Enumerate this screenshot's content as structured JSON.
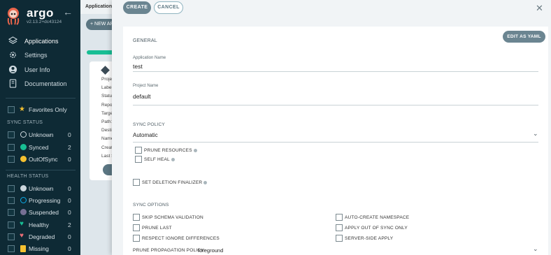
{
  "brand": {
    "name": "argo",
    "version": "v2.13.2+dc43124"
  },
  "nav": [
    {
      "label": "Applications",
      "icon": "layers-icon"
    },
    {
      "label": "Settings",
      "icon": "gear-icon"
    },
    {
      "label": "User Info",
      "icon": "user-icon"
    },
    {
      "label": "Documentation",
      "icon": "book-icon"
    }
  ],
  "favorites_label": "Favorites Only",
  "sync_status": {
    "title": "SYNC STATUS",
    "items": [
      {
        "label": "Unknown",
        "count": "0",
        "color": "#cfdae0"
      },
      {
        "label": "Synced",
        "count": "2",
        "color": "#18be94"
      },
      {
        "label": "OutOfSync",
        "count": "0",
        "color": "#f4c030"
      }
    ]
  },
  "health_status": {
    "title": "HEALTH STATUS",
    "items": [
      {
        "label": "Unknown",
        "count": "0",
        "color": "#ccd6dd"
      },
      {
        "label": "Progressing",
        "count": "0",
        "color": "#0dadea"
      },
      {
        "label": "Suspended",
        "count": "0",
        "color": "#766f94"
      },
      {
        "label": "Healthy",
        "count": "2",
        "color": "#18be94"
      },
      {
        "label": "Degraded",
        "count": "0",
        "color": "#e96d76"
      },
      {
        "label": "Missing",
        "count": "0",
        "color": "#f4c030"
      }
    ]
  },
  "background": {
    "breadcrumb": "Applications",
    "new_app_label": "+ NEW APP",
    "card_fields": [
      "Project:",
      "Labels:",
      "Status:",
      "Repository:",
      "Target R...",
      "Path:",
      "Destination:",
      "Namespace:",
      "Created At:",
      "Last Sync:"
    ]
  },
  "panel": {
    "create_label": "CREATE",
    "cancel_label": "CANCEL",
    "edit_yaml_label": "EDIT AS YAML",
    "general_title": "GENERAL",
    "app_name_label": "Application Name",
    "app_name_value": "test",
    "project_label": "Project Name",
    "project_value": "default",
    "sync_policy_title": "SYNC POLICY",
    "sync_policy_value": "Automatic",
    "prune_resources": "PRUNE RESOURCES",
    "self_heal": "SELF HEAL",
    "deletion_finalizer": "SET DELETION FINALIZER",
    "sync_options_title": "SYNC OPTIONS",
    "options_left": [
      "SKIP SCHEMA VALIDATION",
      "PRUNE LAST",
      "RESPECT IGNORE DIFFERENCES"
    ],
    "options_right": [
      "AUTO-CREATE NAMESPACE",
      "APPLY OUT OF SYNC ONLY",
      "SERVER-SIDE APPLY"
    ],
    "prune_policy_label": "PRUNE PROPAGATION POLICY:",
    "prune_policy_value": "foreground"
  }
}
